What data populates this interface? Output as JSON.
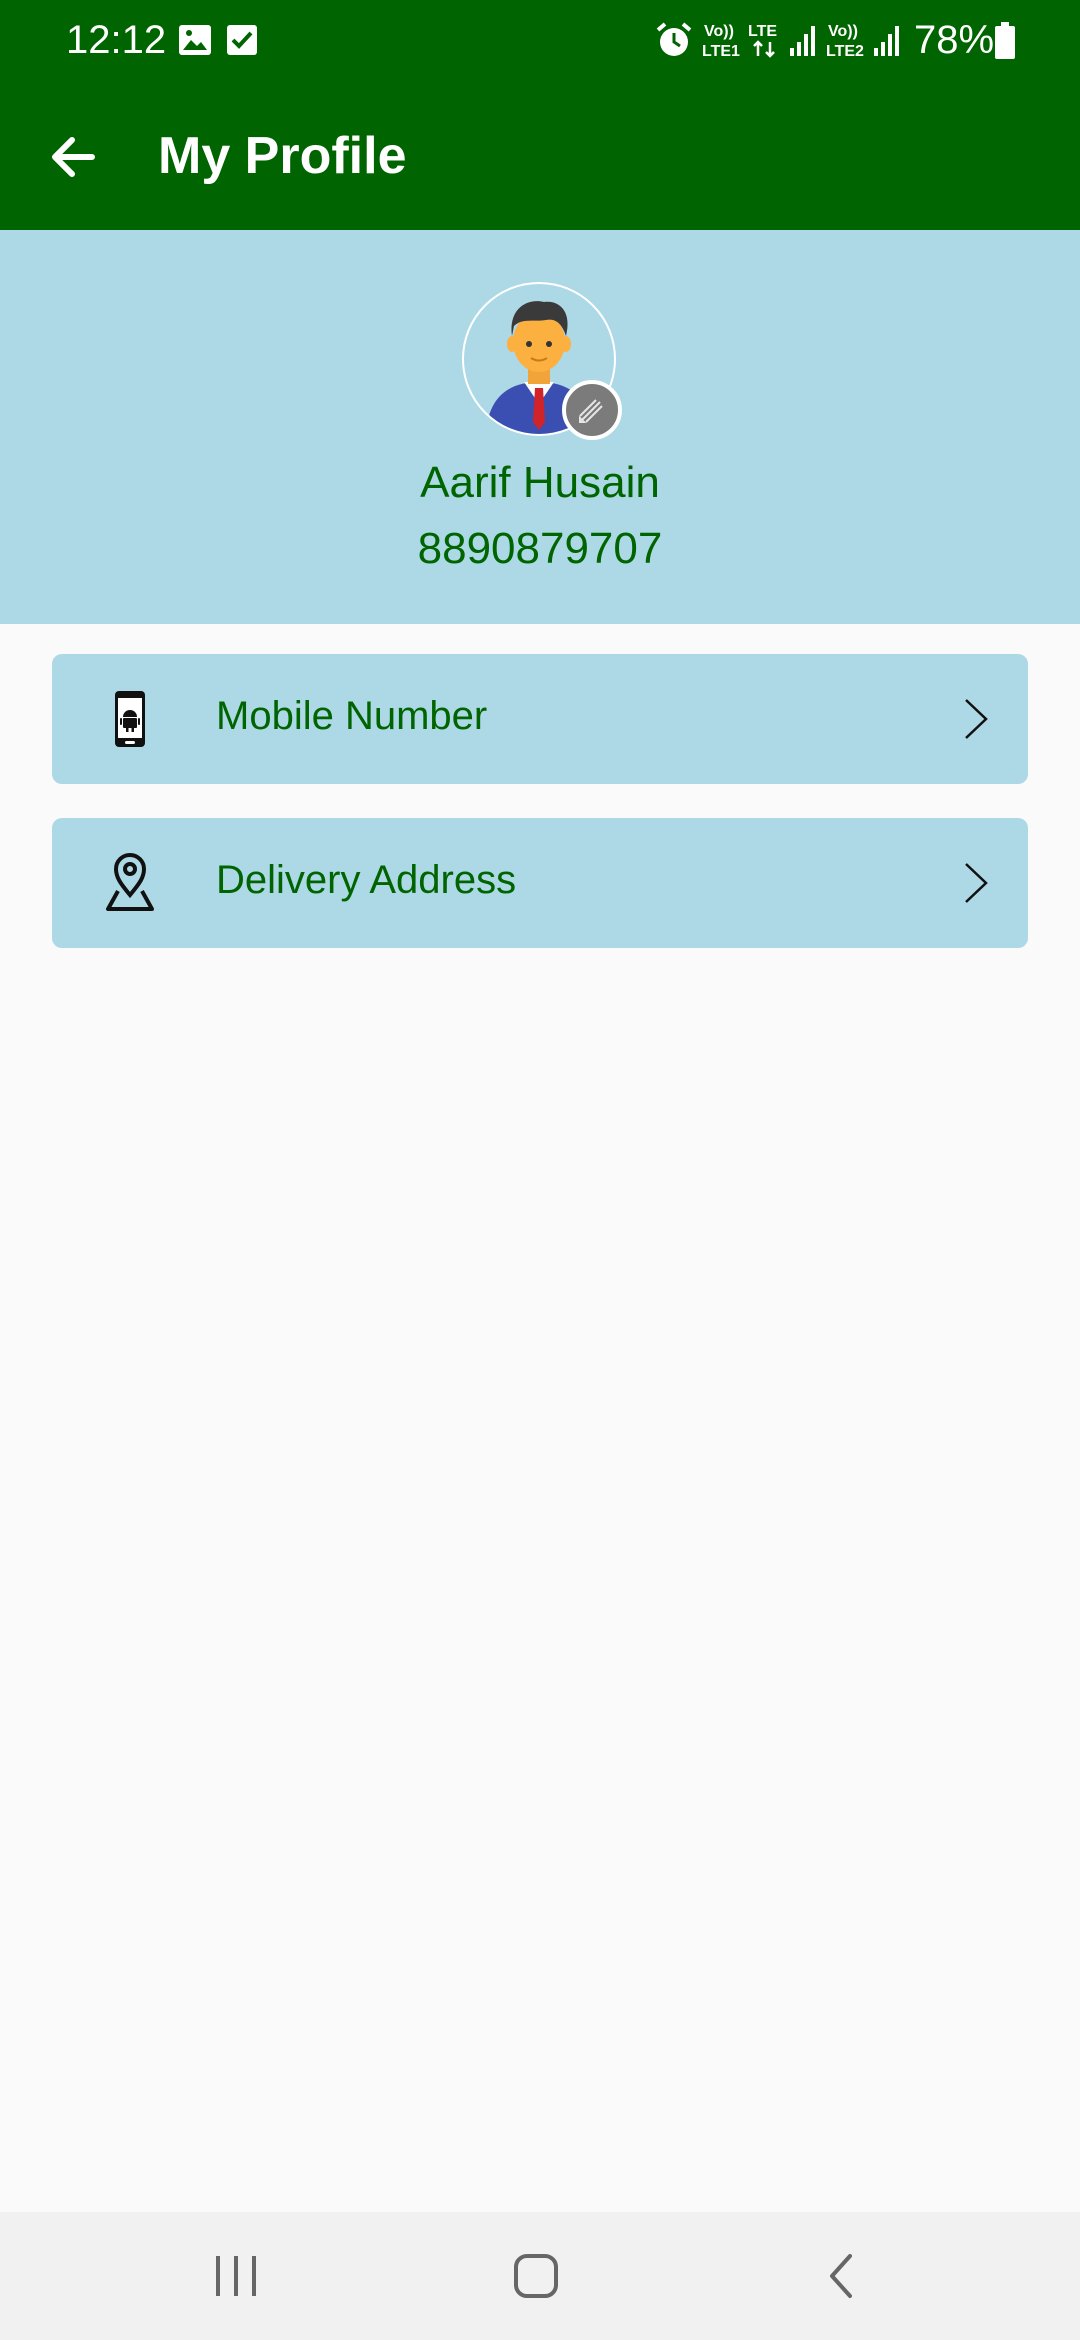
{
  "status_bar": {
    "time": "12:12",
    "battery": "78%",
    "icons": [
      "gallery-icon",
      "checkbox-icon",
      "alarm-icon",
      "volte1-icon",
      "lte-data-icon",
      "signal1-icon",
      "volte2-icon",
      "signal2-icon",
      "battery-icon"
    ]
  },
  "app_bar": {
    "title": "My Profile",
    "back_icon": "arrow-left-icon"
  },
  "profile": {
    "name": "Aarif Husain",
    "phone": "8890879707",
    "avatar_icon": "person-avatar-icon",
    "edit_icon": "edit-pencil-icon"
  },
  "menu": [
    {
      "label": "Mobile Number",
      "icon": "android-phone-icon"
    },
    {
      "label": "Delivery Address",
      "icon": "map-pin-icon"
    }
  ],
  "colors": {
    "primary": "#006400",
    "header_bg": "#add8e6",
    "page_bg": "#fafafa",
    "nav_bg": "#f1f1f1"
  },
  "nav": [
    "recent-apps-icon",
    "home-icon",
    "back-icon"
  ]
}
